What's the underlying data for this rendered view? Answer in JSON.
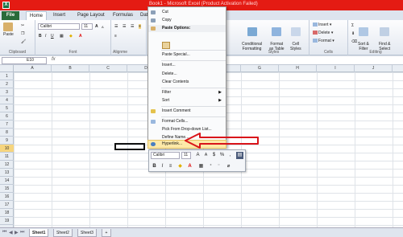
{
  "window": {
    "title": "Book1 - Microsoft Excel (Product Activation Failed)"
  },
  "tabs": [
    "File",
    "Home",
    "Insert",
    "Page Layout",
    "Formulas",
    "Data"
  ],
  "ribbon": {
    "clipboard": {
      "label": "Clipboard",
      "paste": "Paste"
    },
    "font": {
      "label": "Font",
      "name": "Calibri",
      "size": "11",
      "bold": "B",
      "italic": "I",
      "underline": "U",
      "grow": "A",
      "shrink": "A",
      "fontcolor": "A"
    },
    "alignment": {
      "label": "Alignme"
    },
    "styles": {
      "label": "Styles",
      "conditional": "Conditional\nFormatting",
      "format_table": "Format\nas Table",
      "cell_styles": "Cell\nStyles"
    },
    "cells": {
      "label": "Cells",
      "insert": "Insert",
      "delete": "Delete",
      "format": "Format"
    },
    "editing": {
      "label": "Editing",
      "sort": "Sort &\nFilter",
      "find": "Find &\nSelect"
    }
  },
  "formula_bar": {
    "namebox": "E10",
    "fx": "fx"
  },
  "columns": [
    "A",
    "B",
    "C",
    "D",
    "E",
    "F",
    "G",
    "H",
    "I",
    "J"
  ],
  "selected_column": "E",
  "rows": [
    "1",
    "2",
    "3",
    "4",
    "5",
    "6",
    "7",
    "8",
    "9",
    "10",
    "11",
    "12",
    "13",
    "14",
    "15",
    "16",
    "17",
    "18",
    "19"
  ],
  "selected_row": "10",
  "context_menu": {
    "cut": "Cut",
    "copy": "Copy",
    "paste_options": "Paste Options:",
    "paste_special": "Paste Special...",
    "insert": "Insert...",
    "delete": "Delete...",
    "clear_contents": "Clear Contents",
    "filter": "Filter",
    "sort": "Sort",
    "insert_comment": "Insert Comment",
    "format_cells": "Format Cells...",
    "pick_list": "Pick From Drop-down List...",
    "define_name": "Define Name...",
    "hyperlink": "Hyperlink..."
  },
  "mini_toolbar": {
    "font": "Calibri",
    "size": "11",
    "bold": "B",
    "italic": "I",
    "fontcolor": "A"
  },
  "sheets": [
    "Sheet1",
    "Sheet2",
    "Sheet3"
  ],
  "active_sheet": "Sheet1",
  "colors": {
    "title_bar": "#e41b13",
    "file_tab": "#2a6b3a",
    "highlight": "#fde9a8",
    "arrow": "#d9141a",
    "header_selected": "#f6d57e"
  }
}
